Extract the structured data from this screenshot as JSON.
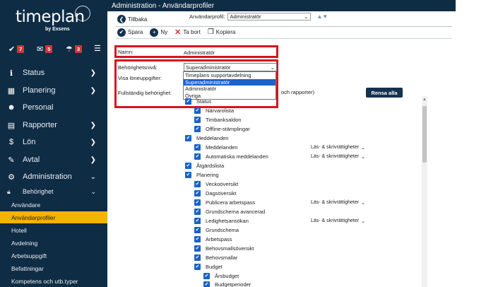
{
  "app": {
    "logo_text": "timeplan",
    "logo_sub": "by Exsens"
  },
  "counters": [
    {
      "icon": "✔",
      "count": "7"
    },
    {
      "icon": "✉",
      "count": "5"
    },
    {
      "icon": "☂",
      "count": "3"
    }
  ],
  "sidebar": {
    "items": [
      {
        "label": "Status",
        "icon": "ℹ"
      },
      {
        "label": "Planering",
        "icon": "▦"
      },
      {
        "label": "Personal",
        "icon": "☻"
      },
      {
        "label": "Rapporter",
        "icon": "▤"
      },
      {
        "label": "Lön",
        "icon": "$"
      },
      {
        "label": "Avtal",
        "icon": "✎"
      },
      {
        "label": "Administration",
        "icon": "⚙"
      }
    ],
    "sub_head": "Behörighet",
    "sub_items": [
      "Användare",
      "Användarprofiler",
      "Hotell",
      "Avdelning",
      "Arbetsuppgift",
      "Befattningar",
      "Kompetens och utb.typer"
    ]
  },
  "header": {
    "title": "Administration - Användarprofiler"
  },
  "toolbar": {
    "back": "Tillbaka",
    "profile_label": "Användarprofil:",
    "profile_value": "Administratör",
    "save": "Spara",
    "new": "Ny",
    "delete": "Ta bort",
    "copy": "Kopiera"
  },
  "form": {
    "name_label": "Namn:",
    "name_value": "Administratör",
    "level_label": "Behörighetsnivå:",
    "level_value": "Superadministratör",
    "level_options": [
      "Timeplans supportavdelning",
      "Superadministratör",
      "Administratör",
      "Övriga"
    ],
    "salary_label": "Visa löneuppgifter:",
    "full_label": "Fullständig behörighet:",
    "full_suffix": "och rapporter)",
    "clear_button": "Rensa alla"
  },
  "permissions": [
    {
      "label": "Status",
      "level": 1
    },
    {
      "label": "Närvarolista",
      "level": 2
    },
    {
      "label": "Timbanksaldon",
      "level": 2
    },
    {
      "label": "Offline-stämplingar",
      "level": 2
    },
    {
      "label": "Meddelanden",
      "level": 1
    },
    {
      "label": "Meddelanden",
      "level": 2,
      "access": "Läs- & skrivrättigheter"
    },
    {
      "label": "Automatiska meddelanden",
      "level": 2,
      "access": "Läs- & skrivrättigheter"
    },
    {
      "label": "Åtgärdslista",
      "level": 1
    },
    {
      "label": "Planering",
      "level": 1
    },
    {
      "label": "Veckoöversikt",
      "level": 2
    },
    {
      "label": "Dagsöversikt",
      "level": 2
    },
    {
      "label": "Publicera arbetspass",
      "level": 2,
      "access": "Läs- & skrivrättigheter"
    },
    {
      "label": "Grundschema avancerad",
      "level": 2
    },
    {
      "label": "Ledighetsansökan",
      "level": 2,
      "access": "Läs- & skrivrättigheter"
    },
    {
      "label": "Grundschema",
      "level": 2
    },
    {
      "label": "Arbetspass",
      "level": 2
    },
    {
      "label": "Behovsmallsöversikt",
      "level": 2
    },
    {
      "label": "Behovsmallar",
      "level": 2
    },
    {
      "label": "Budget",
      "level": 2
    },
    {
      "label": "Årsbudget",
      "level": 3
    },
    {
      "label": "Budgetperioder",
      "level": 3
    }
  ]
}
